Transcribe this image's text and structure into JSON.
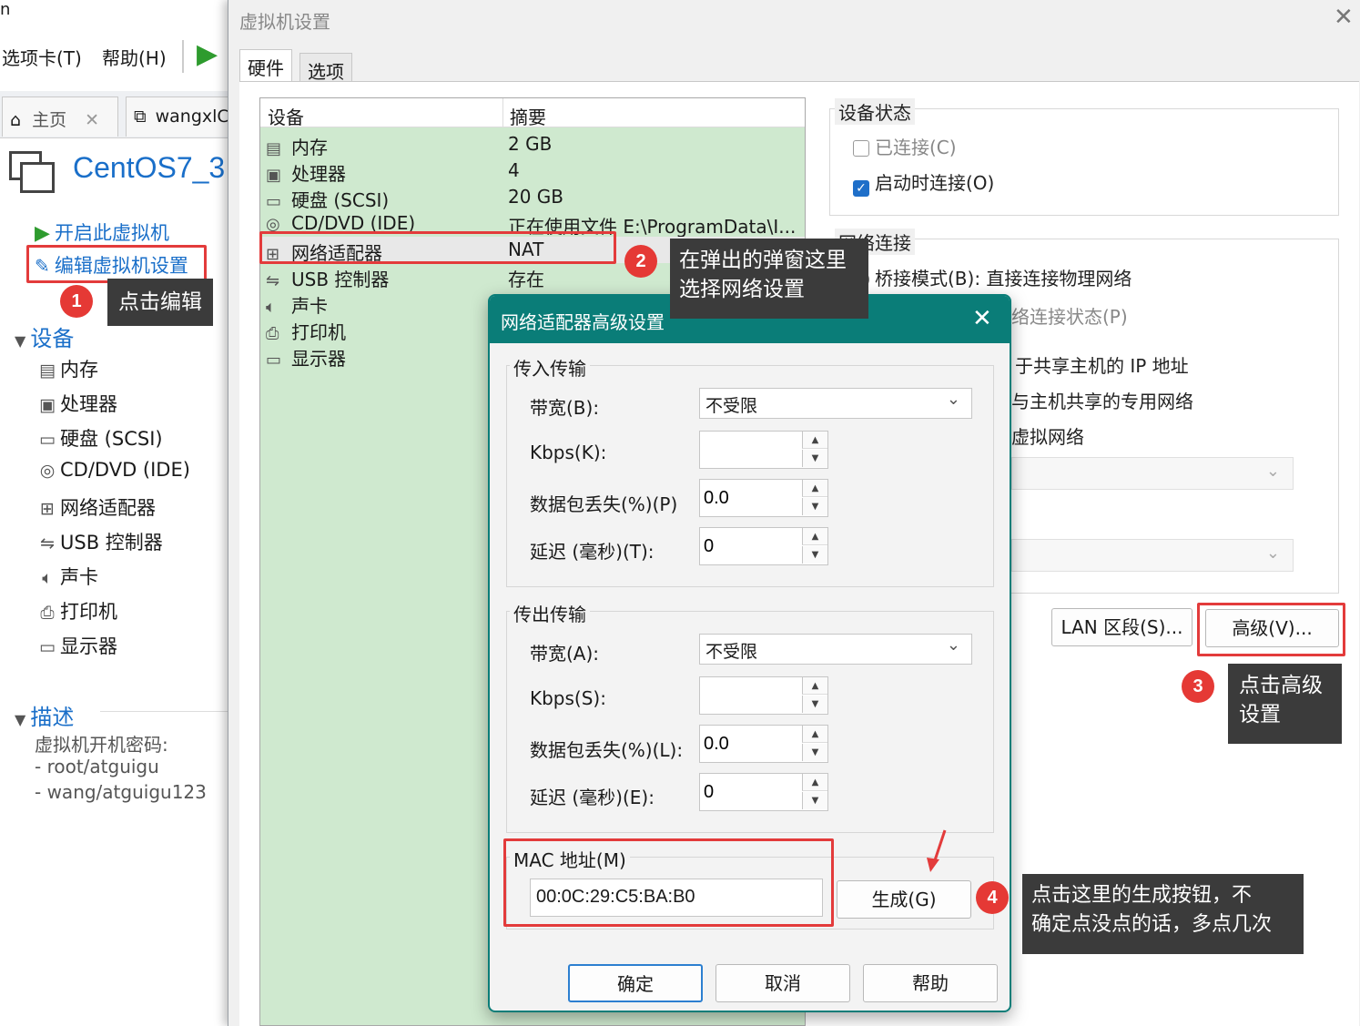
{
  "background_app": {
    "menu": {
      "tabs_menu": "选项卡(T)",
      "help_menu": "帮助(H)"
    },
    "tabs": [
      {
        "label": "主页"
      },
      {
        "label": "wangxlC"
      }
    ],
    "vm_name": "CentOS7_3",
    "actions": {
      "power_on": "开启此虚拟机",
      "edit_settings": "编辑虚拟机设置"
    },
    "devices_header": "设备",
    "devices": [
      {
        "label": "内存",
        "icon": "memory-icon"
      },
      {
        "label": "处理器",
        "icon": "cpu-icon"
      },
      {
        "label": "硬盘 (SCSI)",
        "icon": "harddisk-icon"
      },
      {
        "label": "CD/DVD (IDE)",
        "icon": "cd-icon"
      },
      {
        "label": "网络适配器",
        "icon": "network-icon"
      },
      {
        "label": "USB 控制器",
        "icon": "usb-icon"
      },
      {
        "label": "声卡",
        "icon": "sound-icon"
      },
      {
        "label": "打印机",
        "icon": "printer-icon"
      },
      {
        "label": "显示器",
        "icon": "monitor-icon"
      }
    ],
    "description_header": "描述",
    "description_lines": [
      "虚拟机开机密码:",
      "- root/atguigu",
      "- wang/atguigu123"
    ]
  },
  "settings": {
    "title": "虚拟机设置",
    "tabs": {
      "hardware": "硬件",
      "options": "选项"
    },
    "table_headers": {
      "device": "设备",
      "summary": "摘要"
    },
    "rows": [
      {
        "name": "内存",
        "summary": "2 GB"
      },
      {
        "name": "处理器",
        "summary": "4"
      },
      {
        "name": "硬盘 (SCSI)",
        "summary": "20 GB"
      },
      {
        "name": "CD/DVD (IDE)",
        "summary": "正在使用文件 E:\\ProgramData\\I..."
      },
      {
        "name": "网络适配器",
        "summary": "NAT"
      },
      {
        "name": "USB 控制器",
        "summary": "存在"
      },
      {
        "name": "声卡",
        "summary": ""
      },
      {
        "name": "打印机",
        "summary": ""
      },
      {
        "name": "显示器",
        "summary": ""
      }
    ],
    "device_status": {
      "label": "设备状态",
      "connected": "已连接(C)",
      "connect_at_power_on": "启动时连接(O)",
      "connected_checked": false,
      "connect_at_power_on_checked": true
    },
    "network_connection": {
      "label": "网络连接",
      "bridged": "桥接模式(B): 直接连接物理网络",
      "replicate_state": "络连接状态(P)",
      "nat_partial": "于共享主机的 IP 地址",
      "host_only_partial": "与主机共享的专用网络",
      "custom_partial": "虚拟网络"
    },
    "buttons": {
      "lan_segment": "LAN 区段(S)...",
      "advanced": "高级(V)..."
    }
  },
  "dialog": {
    "title": "网络适配器高级设置",
    "incoming": {
      "label": "传入传输",
      "bandwidth_label": "带宽(B):",
      "bandwidth_value": "不受限",
      "kbps_label": "Kbps(K):",
      "kbps_value": "",
      "loss_label": "数据包丢失(%)(P)",
      "loss_value": "0.0",
      "latency_label": "延迟 (毫秒)(T):",
      "latency_value": "0"
    },
    "outgoing": {
      "label": "传出传输",
      "bandwidth_label": "带宽(A):",
      "bandwidth_value": "不受限",
      "kbps_label": "Kbps(S):",
      "kbps_value": "",
      "loss_label": "数据包丢失(%)(L):",
      "loss_value": "0.0",
      "latency_label": "延迟 (毫秒)(E):",
      "latency_value": "0"
    },
    "mac": {
      "label": "MAC 地址(M)",
      "value": "00:0C:29:C5:BA:B0",
      "generate": "生成(G)"
    },
    "buttons": {
      "ok": "确定",
      "cancel": "取消",
      "help": "帮助"
    }
  },
  "annotations": [
    {
      "number": "1",
      "text": "点击编辑"
    },
    {
      "number": "2",
      "line1": "在弹出的弹窗这里",
      "line2": "选择网络设置"
    },
    {
      "number": "3",
      "line1": "点击高级",
      "line2": "设置"
    },
    {
      "number": "4",
      "line1": "点击这里的生成按钮，不",
      "line2": "确定点没点的话，多点几次"
    }
  ],
  "colors": {
    "accent": "#1a6fc9",
    "dialog_title": "#0a7d78",
    "annotation_red": "#e33b3b",
    "callout_bg": "#3b3b3b",
    "table_green": "#cfe9cf"
  }
}
